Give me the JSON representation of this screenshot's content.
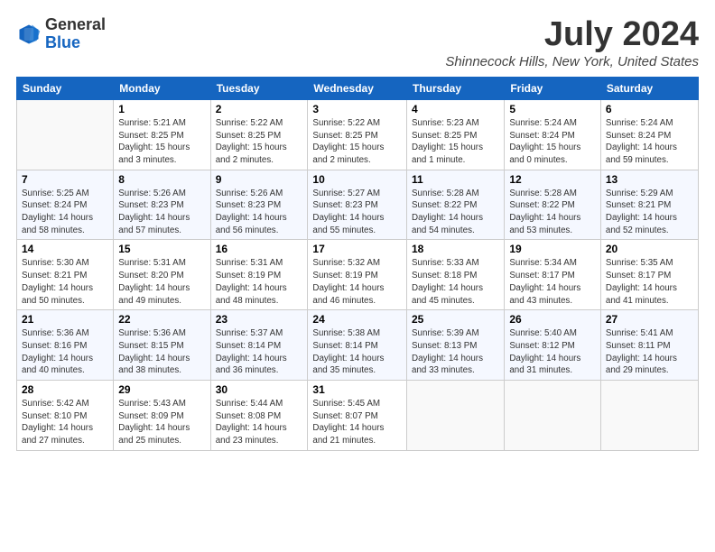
{
  "header": {
    "logo": {
      "general": "General",
      "blue": "Blue"
    },
    "title": "July 2024",
    "location": "Shinnecock Hills, New York, United States"
  },
  "days_of_week": [
    "Sunday",
    "Monday",
    "Tuesday",
    "Wednesday",
    "Thursday",
    "Friday",
    "Saturday"
  ],
  "weeks": [
    [
      {
        "day": "",
        "info": ""
      },
      {
        "day": "1",
        "info": "Sunrise: 5:21 AM\nSunset: 8:25 PM\nDaylight: 15 hours\nand 3 minutes."
      },
      {
        "day": "2",
        "info": "Sunrise: 5:22 AM\nSunset: 8:25 PM\nDaylight: 15 hours\nand 2 minutes."
      },
      {
        "day": "3",
        "info": "Sunrise: 5:22 AM\nSunset: 8:25 PM\nDaylight: 15 hours\nand 2 minutes."
      },
      {
        "day": "4",
        "info": "Sunrise: 5:23 AM\nSunset: 8:25 PM\nDaylight: 15 hours\nand 1 minute."
      },
      {
        "day": "5",
        "info": "Sunrise: 5:24 AM\nSunset: 8:24 PM\nDaylight: 15 hours\nand 0 minutes."
      },
      {
        "day": "6",
        "info": "Sunrise: 5:24 AM\nSunset: 8:24 PM\nDaylight: 14 hours\nand 59 minutes."
      }
    ],
    [
      {
        "day": "7",
        "info": "Sunrise: 5:25 AM\nSunset: 8:24 PM\nDaylight: 14 hours\nand 58 minutes."
      },
      {
        "day": "8",
        "info": "Sunrise: 5:26 AM\nSunset: 8:23 PM\nDaylight: 14 hours\nand 57 minutes."
      },
      {
        "day": "9",
        "info": "Sunrise: 5:26 AM\nSunset: 8:23 PM\nDaylight: 14 hours\nand 56 minutes."
      },
      {
        "day": "10",
        "info": "Sunrise: 5:27 AM\nSunset: 8:23 PM\nDaylight: 14 hours\nand 55 minutes."
      },
      {
        "day": "11",
        "info": "Sunrise: 5:28 AM\nSunset: 8:22 PM\nDaylight: 14 hours\nand 54 minutes."
      },
      {
        "day": "12",
        "info": "Sunrise: 5:28 AM\nSunset: 8:22 PM\nDaylight: 14 hours\nand 53 minutes."
      },
      {
        "day": "13",
        "info": "Sunrise: 5:29 AM\nSunset: 8:21 PM\nDaylight: 14 hours\nand 52 minutes."
      }
    ],
    [
      {
        "day": "14",
        "info": "Sunrise: 5:30 AM\nSunset: 8:21 PM\nDaylight: 14 hours\nand 50 minutes."
      },
      {
        "day": "15",
        "info": "Sunrise: 5:31 AM\nSunset: 8:20 PM\nDaylight: 14 hours\nand 49 minutes."
      },
      {
        "day": "16",
        "info": "Sunrise: 5:31 AM\nSunset: 8:19 PM\nDaylight: 14 hours\nand 48 minutes."
      },
      {
        "day": "17",
        "info": "Sunrise: 5:32 AM\nSunset: 8:19 PM\nDaylight: 14 hours\nand 46 minutes."
      },
      {
        "day": "18",
        "info": "Sunrise: 5:33 AM\nSunset: 8:18 PM\nDaylight: 14 hours\nand 45 minutes."
      },
      {
        "day": "19",
        "info": "Sunrise: 5:34 AM\nSunset: 8:17 PM\nDaylight: 14 hours\nand 43 minutes."
      },
      {
        "day": "20",
        "info": "Sunrise: 5:35 AM\nSunset: 8:17 PM\nDaylight: 14 hours\nand 41 minutes."
      }
    ],
    [
      {
        "day": "21",
        "info": "Sunrise: 5:36 AM\nSunset: 8:16 PM\nDaylight: 14 hours\nand 40 minutes."
      },
      {
        "day": "22",
        "info": "Sunrise: 5:36 AM\nSunset: 8:15 PM\nDaylight: 14 hours\nand 38 minutes."
      },
      {
        "day": "23",
        "info": "Sunrise: 5:37 AM\nSunset: 8:14 PM\nDaylight: 14 hours\nand 36 minutes."
      },
      {
        "day": "24",
        "info": "Sunrise: 5:38 AM\nSunset: 8:14 PM\nDaylight: 14 hours\nand 35 minutes."
      },
      {
        "day": "25",
        "info": "Sunrise: 5:39 AM\nSunset: 8:13 PM\nDaylight: 14 hours\nand 33 minutes."
      },
      {
        "day": "26",
        "info": "Sunrise: 5:40 AM\nSunset: 8:12 PM\nDaylight: 14 hours\nand 31 minutes."
      },
      {
        "day": "27",
        "info": "Sunrise: 5:41 AM\nSunset: 8:11 PM\nDaylight: 14 hours\nand 29 minutes."
      }
    ],
    [
      {
        "day": "28",
        "info": "Sunrise: 5:42 AM\nSunset: 8:10 PM\nDaylight: 14 hours\nand 27 minutes."
      },
      {
        "day": "29",
        "info": "Sunrise: 5:43 AM\nSunset: 8:09 PM\nDaylight: 14 hours\nand 25 minutes."
      },
      {
        "day": "30",
        "info": "Sunrise: 5:44 AM\nSunset: 8:08 PM\nDaylight: 14 hours\nand 23 minutes."
      },
      {
        "day": "31",
        "info": "Sunrise: 5:45 AM\nSunset: 8:07 PM\nDaylight: 14 hours\nand 21 minutes."
      },
      {
        "day": "",
        "info": ""
      },
      {
        "day": "",
        "info": ""
      },
      {
        "day": "",
        "info": ""
      }
    ]
  ]
}
